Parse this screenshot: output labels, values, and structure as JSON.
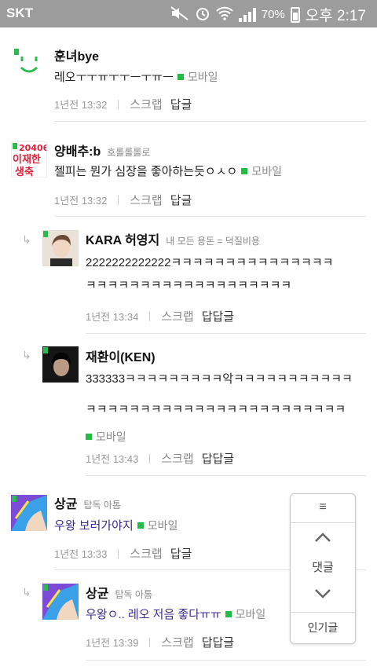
{
  "status_bar": {
    "carrier": "SKT",
    "battery": "70%",
    "time": "오후 2:17"
  },
  "comments": [
    {
      "name": "훈녀bye",
      "subtitle": "",
      "text": "레오ㅜㅜㅠㅜㅜㅡㅜㅠㅡ",
      "mobile": "모바일",
      "time": "1년전 13:32",
      "scrap": "스크랩",
      "reply": "답글"
    },
    {
      "name": "양배추:b",
      "subtitle": "호롤롤롤로",
      "text": "젤피는 뭔가 심장을 좋아하는듯ㅇㅅㅇ",
      "mobile": "모바일",
      "time": "1년전 13:32",
      "scrap": "스크랩",
      "reply": "답글",
      "avatar_text": [
        "20406",
        "이재한",
        "생축"
      ]
    },
    {
      "name": "KARA 허영지",
      "subtitle": "내 모든 용돈 = 덕질비용",
      "text_line1": "2222222222222ㅋㅋㅋㅋㅋㅋㅋㅋㅋㅋㅋㅋㅋㅋㅋ",
      "text_line2": "ㅋㅋㅋㅋㅋㅋㅋㅋㅋㅋㅋㅋㅋㅋㅋㅋㅋㅋㅋ",
      "time": "1년전 13:34",
      "scrap": "스크랩",
      "reply": "답답글"
    },
    {
      "name": "재환이(KEN)",
      "subtitle": "",
      "text_line1": "333333ㅋㅋㅋㅋㅋㅋㅋㅋㅋ악ㅋㅋㅋㅋㅋㅋㅋㅋㅋㅋㅋ",
      "text_line2": "ㅋㅋㅋㅋㅋㅋㅋㅋㅋㅋㅋㅋㅋㅋㅋㅋㅋㅋㅋㅋㅋㅋㅋㅋ",
      "mobile": "모바일",
      "time": "1년전 13:43",
      "scrap": "스크랩",
      "reply": "답답글"
    },
    {
      "name": "상균",
      "subtitle": "탑독 아톰",
      "text": "우왕 보러가야지",
      "mobile": "모바일",
      "time": "1년전 13:33",
      "scrap": "스크랩",
      "reply": "답글"
    },
    {
      "name": "상균",
      "subtitle": "탑독 아톰",
      "text": "우왕ㅇ.. 레오 저음 좋다ㅠㅠ",
      "mobile": "모바일",
      "time": "1년전 13:39",
      "scrap": "스크랩",
      "reply": "답답글"
    }
  ],
  "float_panel": {
    "menu_icon": "≡",
    "comments_label": "댓글",
    "popular_label": "인기글"
  },
  "colors": {
    "status_bar_bg": "#9c9c9c",
    "mobile_dot": "#22bb44",
    "link_text": "#3a2b8f"
  }
}
